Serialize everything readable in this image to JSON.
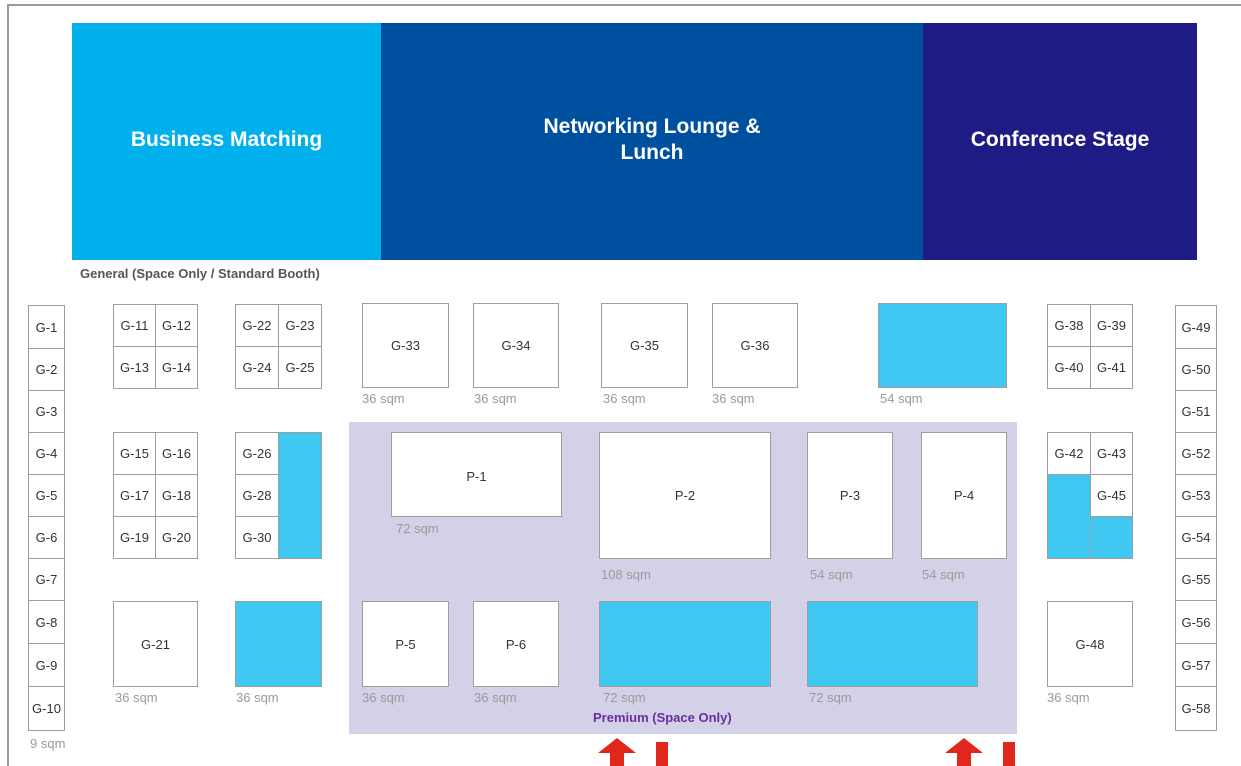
{
  "zones": [
    {
      "label": "Business Matching",
      "color": "#00b0ec"
    },
    {
      "label": "Networking Lounge & Lunch",
      "color": "#0050a0"
    },
    {
      "label": "Conference Stage",
      "color": "#1e1b84"
    }
  ],
  "general_label": "General (Space Only / Standard Booth)",
  "premium_label": "Premium (Space Only)",
  "colors": {
    "available_fill": "#40c8f3",
    "premium_area": "#d3d1e8",
    "entrance_arrow": "#e1261c"
  },
  "booths": {
    "g1": "G-1",
    "g2": "G-2",
    "g3": "G-3",
    "g4": "G-4",
    "g5": "G-5",
    "g6": "G-6",
    "g7": "G-7",
    "g8": "G-8",
    "g9": "G-9",
    "g10": "G-10",
    "g11": "G-11",
    "g12": "G-12",
    "g13": "G-13",
    "g14": "G-14",
    "g15": "G-15",
    "g16": "G-16",
    "g17": "G-17",
    "g18": "G-18",
    "g19": "G-19",
    "g20": "G-20",
    "g21": "G-21",
    "g22": "G-22",
    "g23": "G-23",
    "g24": "G-24",
    "g25": "G-25",
    "g26": "G-26",
    "g28": "G-28",
    "g30": "G-30",
    "g33": "G-33",
    "g34": "G-34",
    "g35": "G-35",
    "g36": "G-36",
    "g38": "G-38",
    "g39": "G-39",
    "g40": "G-40",
    "g41": "G-41",
    "g42": "G-42",
    "g43": "G-43",
    "g45": "G-45",
    "g48": "G-48",
    "g49": "G-49",
    "g50": "G-50",
    "g51": "G-51",
    "g52": "G-52",
    "g53": "G-53",
    "g54": "G-54",
    "g55": "G-55",
    "g56": "G-56",
    "g57": "G-57",
    "g58": "G-58",
    "p1": "P-1",
    "p2": "P-2",
    "p3": "P-3",
    "p4": "P-4",
    "p5": "P-5",
    "p6": "P-6"
  },
  "areas": {
    "sqm9": "9 sqm",
    "sqm36": "36 sqm",
    "sqm54": "54 sqm",
    "sqm72": "72 sqm",
    "sqm108": "108 sqm"
  }
}
